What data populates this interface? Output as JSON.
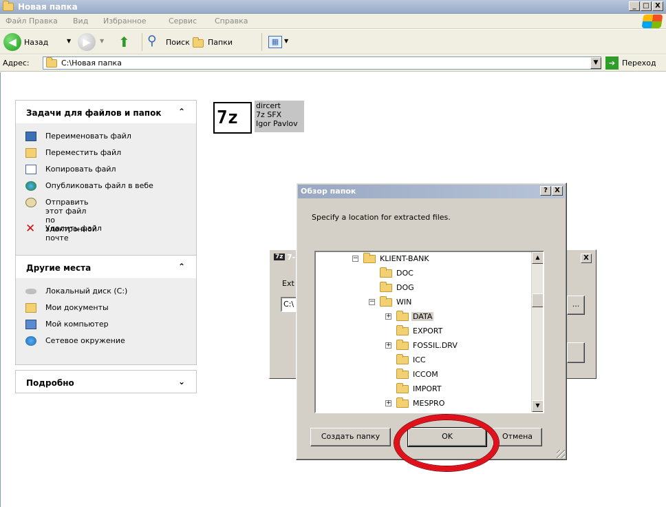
{
  "window": {
    "title": "Новая папка",
    "controls": [
      "_",
      "□",
      "X"
    ]
  },
  "menu": [
    "Файл",
    "Правка",
    "Вид",
    "Избранное",
    "Сервис",
    "Справка"
  ],
  "toolbar": {
    "back_label": "Назад",
    "search_label": "Поиск",
    "folders_label": "Папки"
  },
  "address": {
    "label": "Адрес:",
    "value": "C:\\Новая папка",
    "go_label": "Переход"
  },
  "tasks_panel": {
    "title": "Задачи для файлов и папок",
    "items": [
      "Переименовать файл",
      "Переместить файл",
      "Копировать файл",
      "Опубликовать файл в вебе",
      "Отправить этот файл по\nэлектронной почте",
      "Удалить файл"
    ]
  },
  "places_panel": {
    "title": "Другие места",
    "items": [
      "Локальный диск (C:)",
      "Мои документы",
      "Мой компьютер",
      "Сетевое окружение"
    ]
  },
  "details_panel": {
    "title": "Подробно"
  },
  "file": {
    "icon_text": "7z",
    "name": "dircert",
    "type": "7z SFX",
    "author": "Igor Pavlov"
  },
  "bg_dialog": {
    "title_icon": "7z",
    "title_fragment": "7-",
    "label_fragment": "Ext",
    "field_fragment": "C:\\",
    "close": "X",
    "browse": "..."
  },
  "browse_dialog": {
    "title": "Обзор папок",
    "help": "?",
    "close": "X",
    "description": "Specify a location for extracted files.",
    "tree": [
      {
        "label": "KLIENT-BANK",
        "expander": "−",
        "level": 0
      },
      {
        "label": "DOC",
        "expander": "",
        "level": 1
      },
      {
        "label": "DOG",
        "expander": "",
        "level": 1
      },
      {
        "label": "WIN",
        "expander": "−",
        "level": 1
      },
      {
        "label": "DATA",
        "expander": "+",
        "level": 2,
        "selected": true
      },
      {
        "label": "EXPORT",
        "expander": "",
        "level": 2
      },
      {
        "label": "FOSSIL.DRV",
        "expander": "+",
        "level": 2
      },
      {
        "label": "ICC",
        "expander": "",
        "level": 2
      },
      {
        "label": "ICCOM",
        "expander": "",
        "level": 2
      },
      {
        "label": "IMPORT",
        "expander": "",
        "level": 2
      },
      {
        "label": "MESPRO",
        "expander": "+",
        "level": 2
      }
    ],
    "buttons": {
      "new_folder": "Создать папку",
      "ok": "OK",
      "cancel": "Отмена"
    }
  },
  "colors": {
    "highlight_ring": "#e0111b",
    "title_bar": "#99a8c2",
    "folder": "#f3d172"
  }
}
